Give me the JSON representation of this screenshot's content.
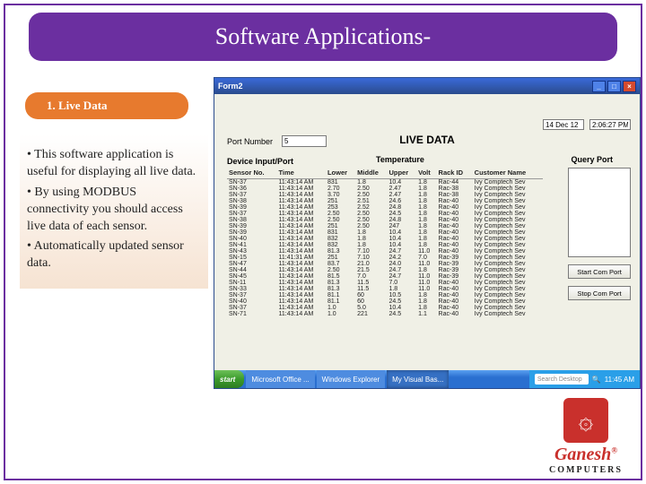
{
  "title": "Software Applications-",
  "subtitle": "1. Live Data",
  "bullets": [
    "This software application  is useful for displaying all live data.",
    "By using MODBUS connectivity you should access live data of each sensor.",
    "Automatically updated sensor data."
  ],
  "window": {
    "title": "Form2",
    "date": "14 Dec 12",
    "time": "2:06:27 PM",
    "port_label": "Port Number",
    "port_value": "5",
    "live_data": "LIVE DATA",
    "device_label": "Device Input/Port",
    "temp_label": "Temperature",
    "query_label": "Query Port",
    "columns": [
      "Sensor No.",
      "Time",
      "Lower",
      "Middle",
      "Upper",
      "Volt",
      "Rack ID",
      "Customer Name"
    ],
    "rows": [
      [
        "SN-37",
        "11:43:14 AM",
        "831",
        "1.8",
        "10.4",
        "1.8",
        "Rac-44",
        "Ivy Comptech Sev"
      ],
      [
        "SN-36",
        "11:43:14 AM",
        "2.70",
        "2.50",
        "2.47",
        "1.8",
        "Rac-38",
        "Ivy Comptech Sev"
      ],
      [
        "SN-37",
        "11:43:14 AM",
        "3.70",
        "2.50",
        "2.47",
        "1.8",
        "Rac-38",
        "Ivy Comptech Sev"
      ],
      [
        "SN-38",
        "11:43:14 AM",
        "251",
        "2.51",
        "24.6",
        "1.8",
        "Rac-40",
        "Ivy Comptech Sev"
      ],
      [
        "SN-39",
        "11:43:14 AM",
        "253",
        "2.52",
        "24.8",
        "1.8",
        "Rac-40",
        "Ivy Comptech Sev"
      ],
      [
        "SN-37",
        "11:43:14 AM",
        "2.50",
        "2.50",
        "24.5",
        "1.8",
        "Rac-40",
        "Ivy Comptech Sev"
      ],
      [
        "SN-38",
        "11:43:14 AM",
        "2.50",
        "2.50",
        "24.8",
        "1.8",
        "Rac-40",
        "Ivy Comptech Sev"
      ],
      [
        "SN-39",
        "11:43:14 AM",
        "251",
        "2.50",
        "247",
        "1.8",
        "Rac-40",
        "Ivy Comptech Sev"
      ],
      [
        "SN-39",
        "11:43:14 AM",
        "831",
        "1.8",
        "10.4",
        "1.8",
        "Rac-40",
        "Ivy Comptech Sev"
      ],
      [
        "SN-40",
        "11:43:14 AM",
        "832",
        "1.8",
        "10.4",
        "1.8",
        "Rac-40",
        "Ivy Comptech Sev"
      ],
      [
        "SN-41",
        "11:43:14 AM",
        "832",
        "1.8",
        "10.4",
        "1.8",
        "Rac-40",
        "Ivy Comptech Sev"
      ],
      [
        "SN-43",
        "11:43:14 AM",
        "81.3",
        "7.10",
        "24.7",
        "11.0",
        "Rac-40",
        "Ivy Comptech Sev"
      ],
      [
        "SN-15",
        "11:41:31 AM",
        "251",
        "7.10",
        "24.2",
        "7.0",
        "Rac-39",
        "Ivy Comptech Sev"
      ],
      [
        "SN-47",
        "11:43:14 AM",
        "83.7",
        "21.0",
        "24.0",
        "11.0",
        "Rac-39",
        "Ivy Comptech Sev"
      ],
      [
        "SN-44",
        "11:43:14 AM",
        "2.50",
        "21.5",
        "24.7",
        "1.8",
        "Rac-39",
        "Ivy Comptech Sev"
      ],
      [
        "SN-45",
        "11:43:14 AM",
        "81.5",
        "7.0",
        "24.7",
        "11.0",
        "Rac-39",
        "Ivy Comptech Sev"
      ],
      [
        "SN-11",
        "11:43:14 AM",
        "81.3",
        "11.5",
        "7.0",
        "11.0",
        "Rac-40",
        "Ivy Comptech Sev"
      ],
      [
        "SN-33",
        "11:43:14 AM",
        "81.3",
        "11.5",
        "1.8",
        "11.0",
        "Rac-40",
        "Ivy Comptech Sev"
      ],
      [
        "SN-37",
        "11:43:14 AM",
        "81.1",
        "60",
        "10.5",
        "1.8",
        "Rac-40",
        "Ivy Comptech Sev"
      ],
      [
        "SN-40",
        "11:43:14 AM",
        "81.1",
        "60",
        "24.5",
        "1.8",
        "Rac-40",
        "Ivy Comptech Sev"
      ],
      [
        "SN-37",
        "11:43:14 AM",
        "1.0",
        "5.0",
        "10.4",
        "1.8",
        "Rac-40",
        "Ivy Comptech Sev"
      ],
      [
        "SN-71",
        "11:43:14 AM",
        "1.0",
        "221",
        "24.5",
        "1.1",
        "Rac-40",
        "Ivy Comptech Sev"
      ]
    ],
    "btn_start": "Start Com Port",
    "btn_stop": "Stop Com Port"
  },
  "taskbar": {
    "start": "start",
    "items": [
      "Microsoft Office ...",
      "Windows Explorer",
      "My Visual Bas..."
    ],
    "search_placeholder": "Search Desktop",
    "clock": "11:45 AM"
  },
  "logo": {
    "name": "Ganesh",
    "sub": "COMPUTERS"
  }
}
